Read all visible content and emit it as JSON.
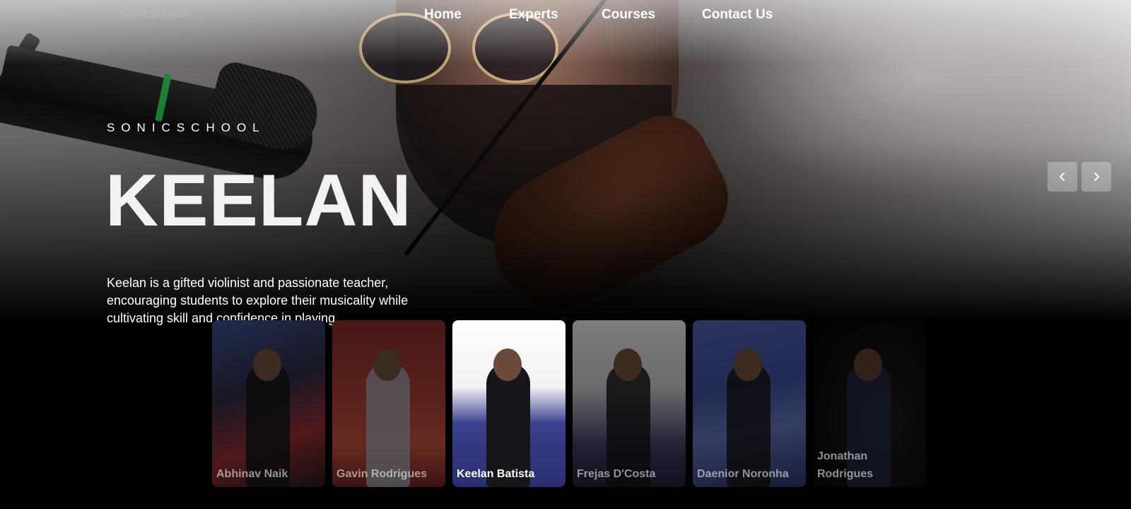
{
  "brand": {
    "ghost_label": "SonicSchool"
  },
  "nav": {
    "items": [
      {
        "label": "Home"
      },
      {
        "label": "Experts"
      },
      {
        "label": "Courses"
      },
      {
        "label": "Contact Us"
      }
    ]
  },
  "hero": {
    "school_name": "SONICSCHOOL",
    "title": "KEELAN",
    "description": "Keelan is a gifted violinist and passionate teacher, encouraging students to explore their musicality while cultivating skill and confidence in playing."
  },
  "carousel": {
    "prev_icon": "chevron-left-icon",
    "next_icon": "chevron-right-icon",
    "cards": [
      {
        "name": "Abhinav Naik",
        "active": false
      },
      {
        "name": "Gavin Rodrigues",
        "active": false
      },
      {
        "name": "Keelan Batista",
        "active": true
      },
      {
        "name": "Frejas D'Costa",
        "active": false
      },
      {
        "name": "Daenior Noronha",
        "active": false
      },
      {
        "name": "Jonathan Rodrigues",
        "active": false
      }
    ]
  },
  "colors": {
    "background": "#000000",
    "text": "#ffffff",
    "arrow_bg": "rgba(255,255,255,0.28)"
  }
}
